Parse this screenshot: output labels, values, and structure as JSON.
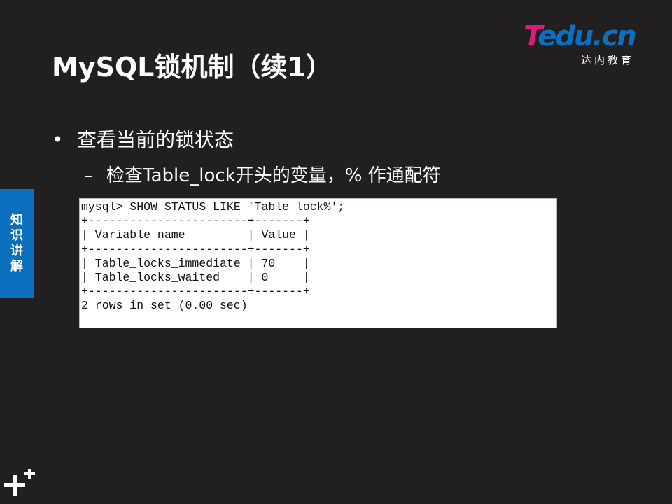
{
  "slide": {
    "title": "MySQL锁机制（续1）"
  },
  "logo": {
    "main_t": "T",
    "main_rest": "edu.cn",
    "sub": "达内教育"
  },
  "side_tab": {
    "chars": [
      "知",
      "识",
      "讲",
      "解"
    ]
  },
  "bullets": {
    "level1_marker": "•",
    "level1": "查看当前的锁状态",
    "level2_marker": "–",
    "level2": "检查Table_lock开头的变量，% 作通配符"
  },
  "terminal": {
    "lines": [
      "mysql> SHOW STATUS LIKE 'Table_lock%';",
      "+-----------------------+-------+",
      "| Variable_name         | Value |",
      "+-----------------------+-------+",
      "| Table_locks_immediate | 70    |",
      "| Table_locks_waited    | 0     |",
      "+-----------------------+-------+",
      "2 rows in set (0.00 sec)"
    ]
  },
  "colors": {
    "background": "#221f20",
    "side_tab": "#0b6fbd",
    "logo_pink": "#e0197d",
    "logo_blue": "#0d6fc0"
  },
  "icons": {
    "corner": "plus-icon"
  }
}
